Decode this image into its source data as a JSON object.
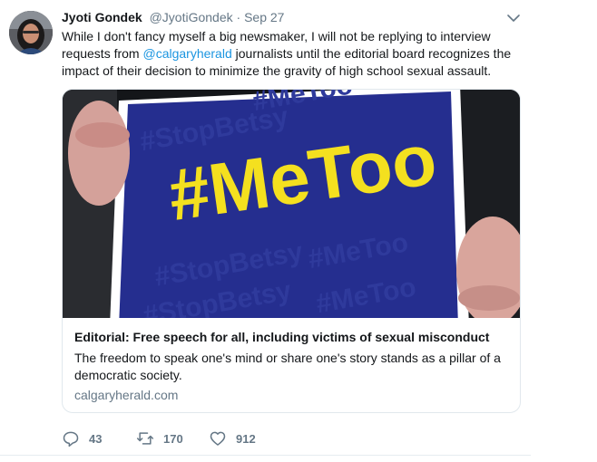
{
  "tweet": {
    "name": "Jyoti Gondek",
    "handle": "@JyotiGondek",
    "separator": "·",
    "time": "Sep 27",
    "text_before": "While I don't fancy myself a big newsmaker, I will not be replying to interview requests from ",
    "mention": "@calgaryherald",
    "text_after": " journalists until the editorial board recognizes the impact of their decision to minimize the gravity of high school sexual assault."
  },
  "card": {
    "image_text": "#MeToo",
    "image_background_text": [
      "#MeToo",
      "#StopBetsy",
      "#StopBetsy",
      "#StopBetsy",
      "#MeToo",
      "#MeToo"
    ],
    "title": "Editorial: Free speech for all, including victims of sexual misconduct",
    "description": "The freedom to speak one's mind or share one's story stands as a pillar of a democratic society.",
    "domain": "calgaryherald.com"
  },
  "actions": {
    "reply_count": "43",
    "retweet_count": "170",
    "like_count": "912"
  },
  "colors": {
    "link": "#1b95e0",
    "secondary_text": "#657786",
    "sign_blue": "#252e8f",
    "sign_yellow": "#f4e01f"
  },
  "icons": [
    "avatar",
    "chevron-down-icon",
    "reply-icon",
    "retweet-icon",
    "heart-icon"
  ]
}
